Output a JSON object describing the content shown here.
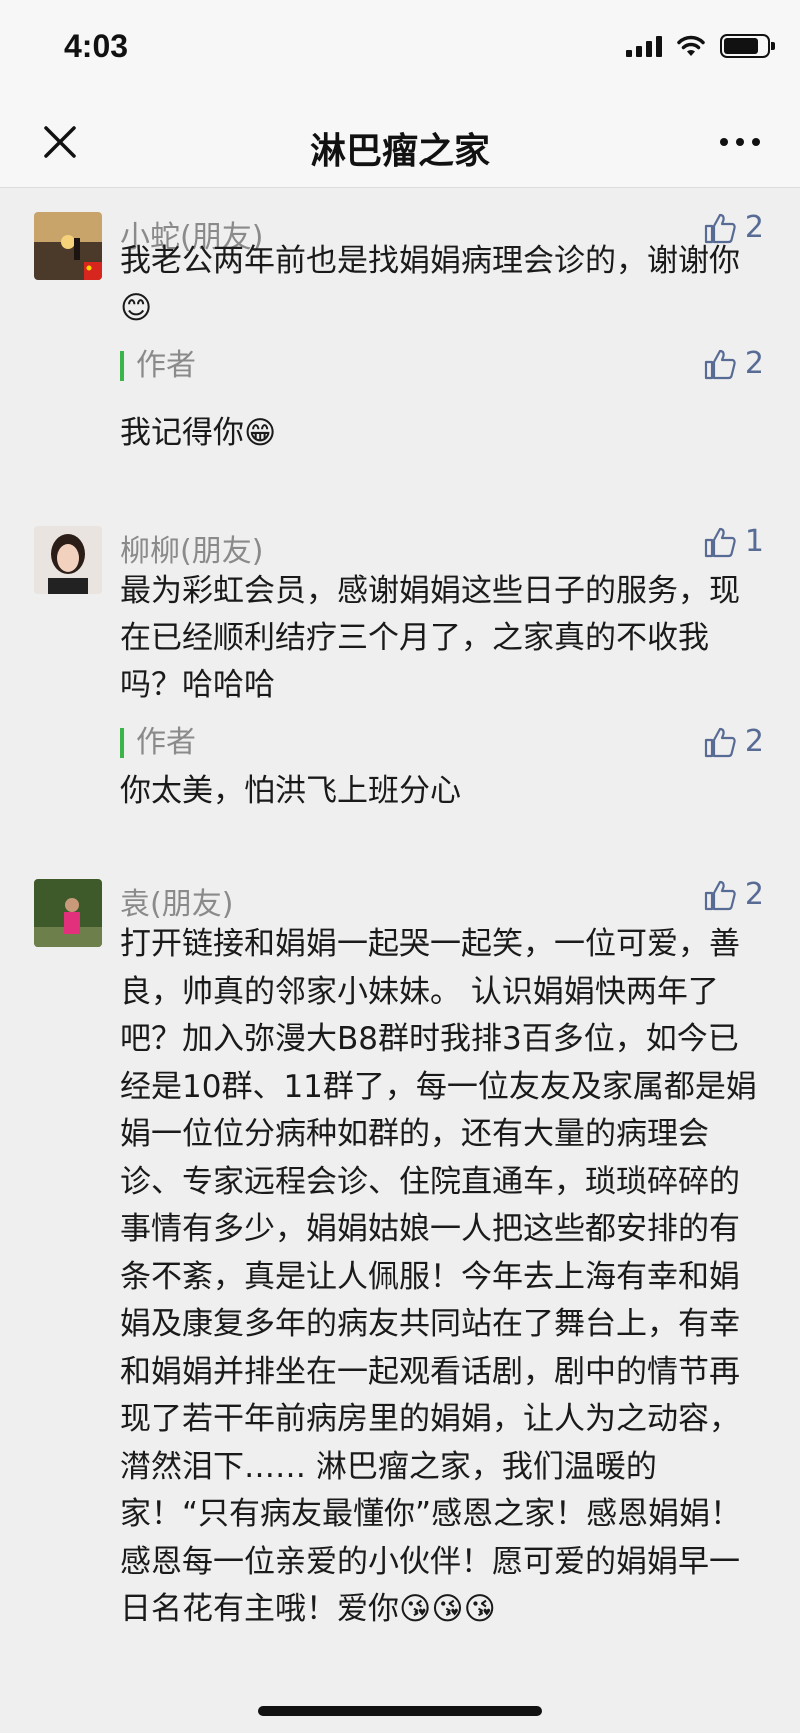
{
  "status": {
    "time": "4:03"
  },
  "nav": {
    "title": "淋巴瘤之家"
  },
  "comments": [
    {
      "name": "小蛇(朋友)",
      "likes": "2",
      "text": "我老公两年前也是找娟娟病理会诊的，谢谢你😊",
      "reply": {
        "author": "作者",
        "likes": "2",
        "text": "我记得你😁"
      }
    },
    {
      "name": "柳柳(朋友)",
      "likes": "1",
      "text": "最为彩虹会员，感谢娟娟这些日子的服务，现在已经顺利结疗三个月了，之家真的不收我吗？哈哈哈",
      "reply": {
        "author": "作者",
        "likes": "2",
        "text": "你太美，怕洪飞上班分心"
      }
    },
    {
      "name": "袁(朋友)",
      "likes": "2",
      "text": "打开链接和娟娟一起哭一起笑，一位可爱，善良，帅真的邻家小妹妹。 认识娟娟快两年了吧？加入弥漫大B8群时我排3百多位，如今已经是10群、11群了，每一位友友及家属都是娟娟一位位分病种如群的，还有大量的病理会诊、专家远程会诊、住院直通车，琐琐碎碎的事情有多少，娟娟姑娘一人把这些都安排的有条不紊，真是让人佩服！今年去上海有幸和娟娟及康复多年的病友共同站在了舞台上，有幸和娟娟并排坐在一起观看话剧，剧中的情节再现了若干年前病房里的娟娟，让人为之动容，潸然泪下…… 淋巴瘤之家，我们温暖的家！“只有病友最懂你”感恩之家！感恩娟娟！感恩每一位亲爱的小伙伴！愿可爱的娟娟早一日名花有主哦！爱你😘😘😘"
    }
  ]
}
